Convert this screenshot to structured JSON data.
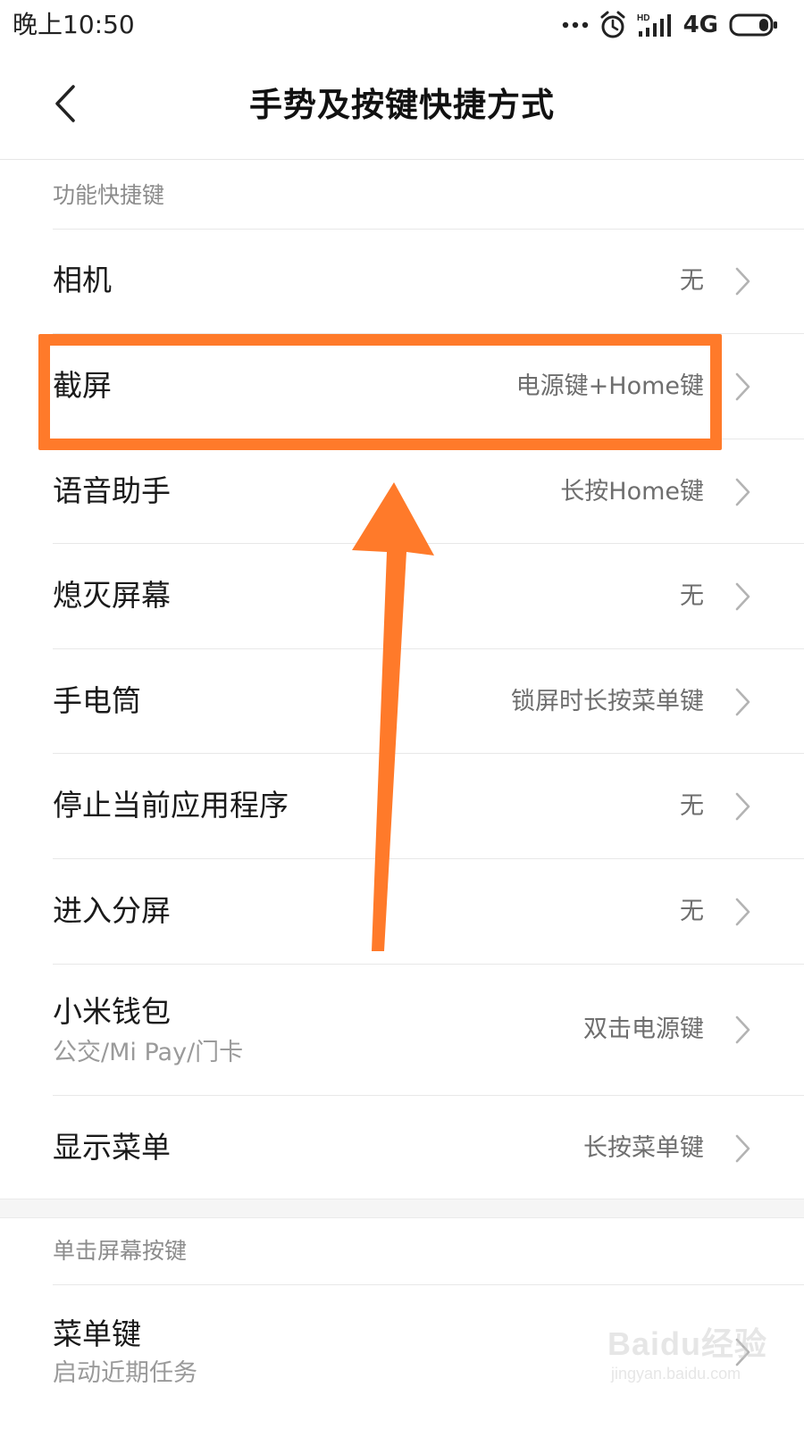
{
  "status_bar": {
    "time": "晚上10:50",
    "network": "4G",
    "icons": [
      "more-dots-icon",
      "alarm-icon",
      "hd-signal-icon",
      "battery-icon"
    ]
  },
  "header": {
    "title": "手势及按键快捷方式",
    "back_icon": "chevron-left-icon"
  },
  "sections": [
    {
      "title": "功能快捷键",
      "items": [
        {
          "label": "相机",
          "value": "无"
        },
        {
          "label": "截屏",
          "value": "电源键+Home键"
        },
        {
          "label": "语音助手",
          "value": "长按Home键"
        },
        {
          "label": "熄灭屏幕",
          "value": "无"
        },
        {
          "label": "手电筒",
          "value": "锁屏时长按菜单键"
        },
        {
          "label": "停止当前应用程序",
          "value": "无"
        },
        {
          "label": "进入分屏",
          "value": "无"
        },
        {
          "label": "小米钱包",
          "sublabel": "公交/Mi Pay/门卡",
          "value": "双击电源键"
        },
        {
          "label": "显示菜单",
          "value": "长按菜单键"
        }
      ]
    },
    {
      "title": "单击屏幕按键",
      "items": [
        {
          "label": "菜单键",
          "sublabel": "启动近期任务",
          "value": ""
        }
      ]
    }
  ],
  "annotation": {
    "color": "#ff7a2a"
  },
  "watermark": {
    "text": "Baidu经验",
    "sub": "jingyan.baidu.com"
  },
  "colors": {
    "accent": "#ff7a2a",
    "text_primary": "#1a1a1a",
    "text_secondary": "#6e6e6e",
    "section_header": "#8c8c8c"
  }
}
